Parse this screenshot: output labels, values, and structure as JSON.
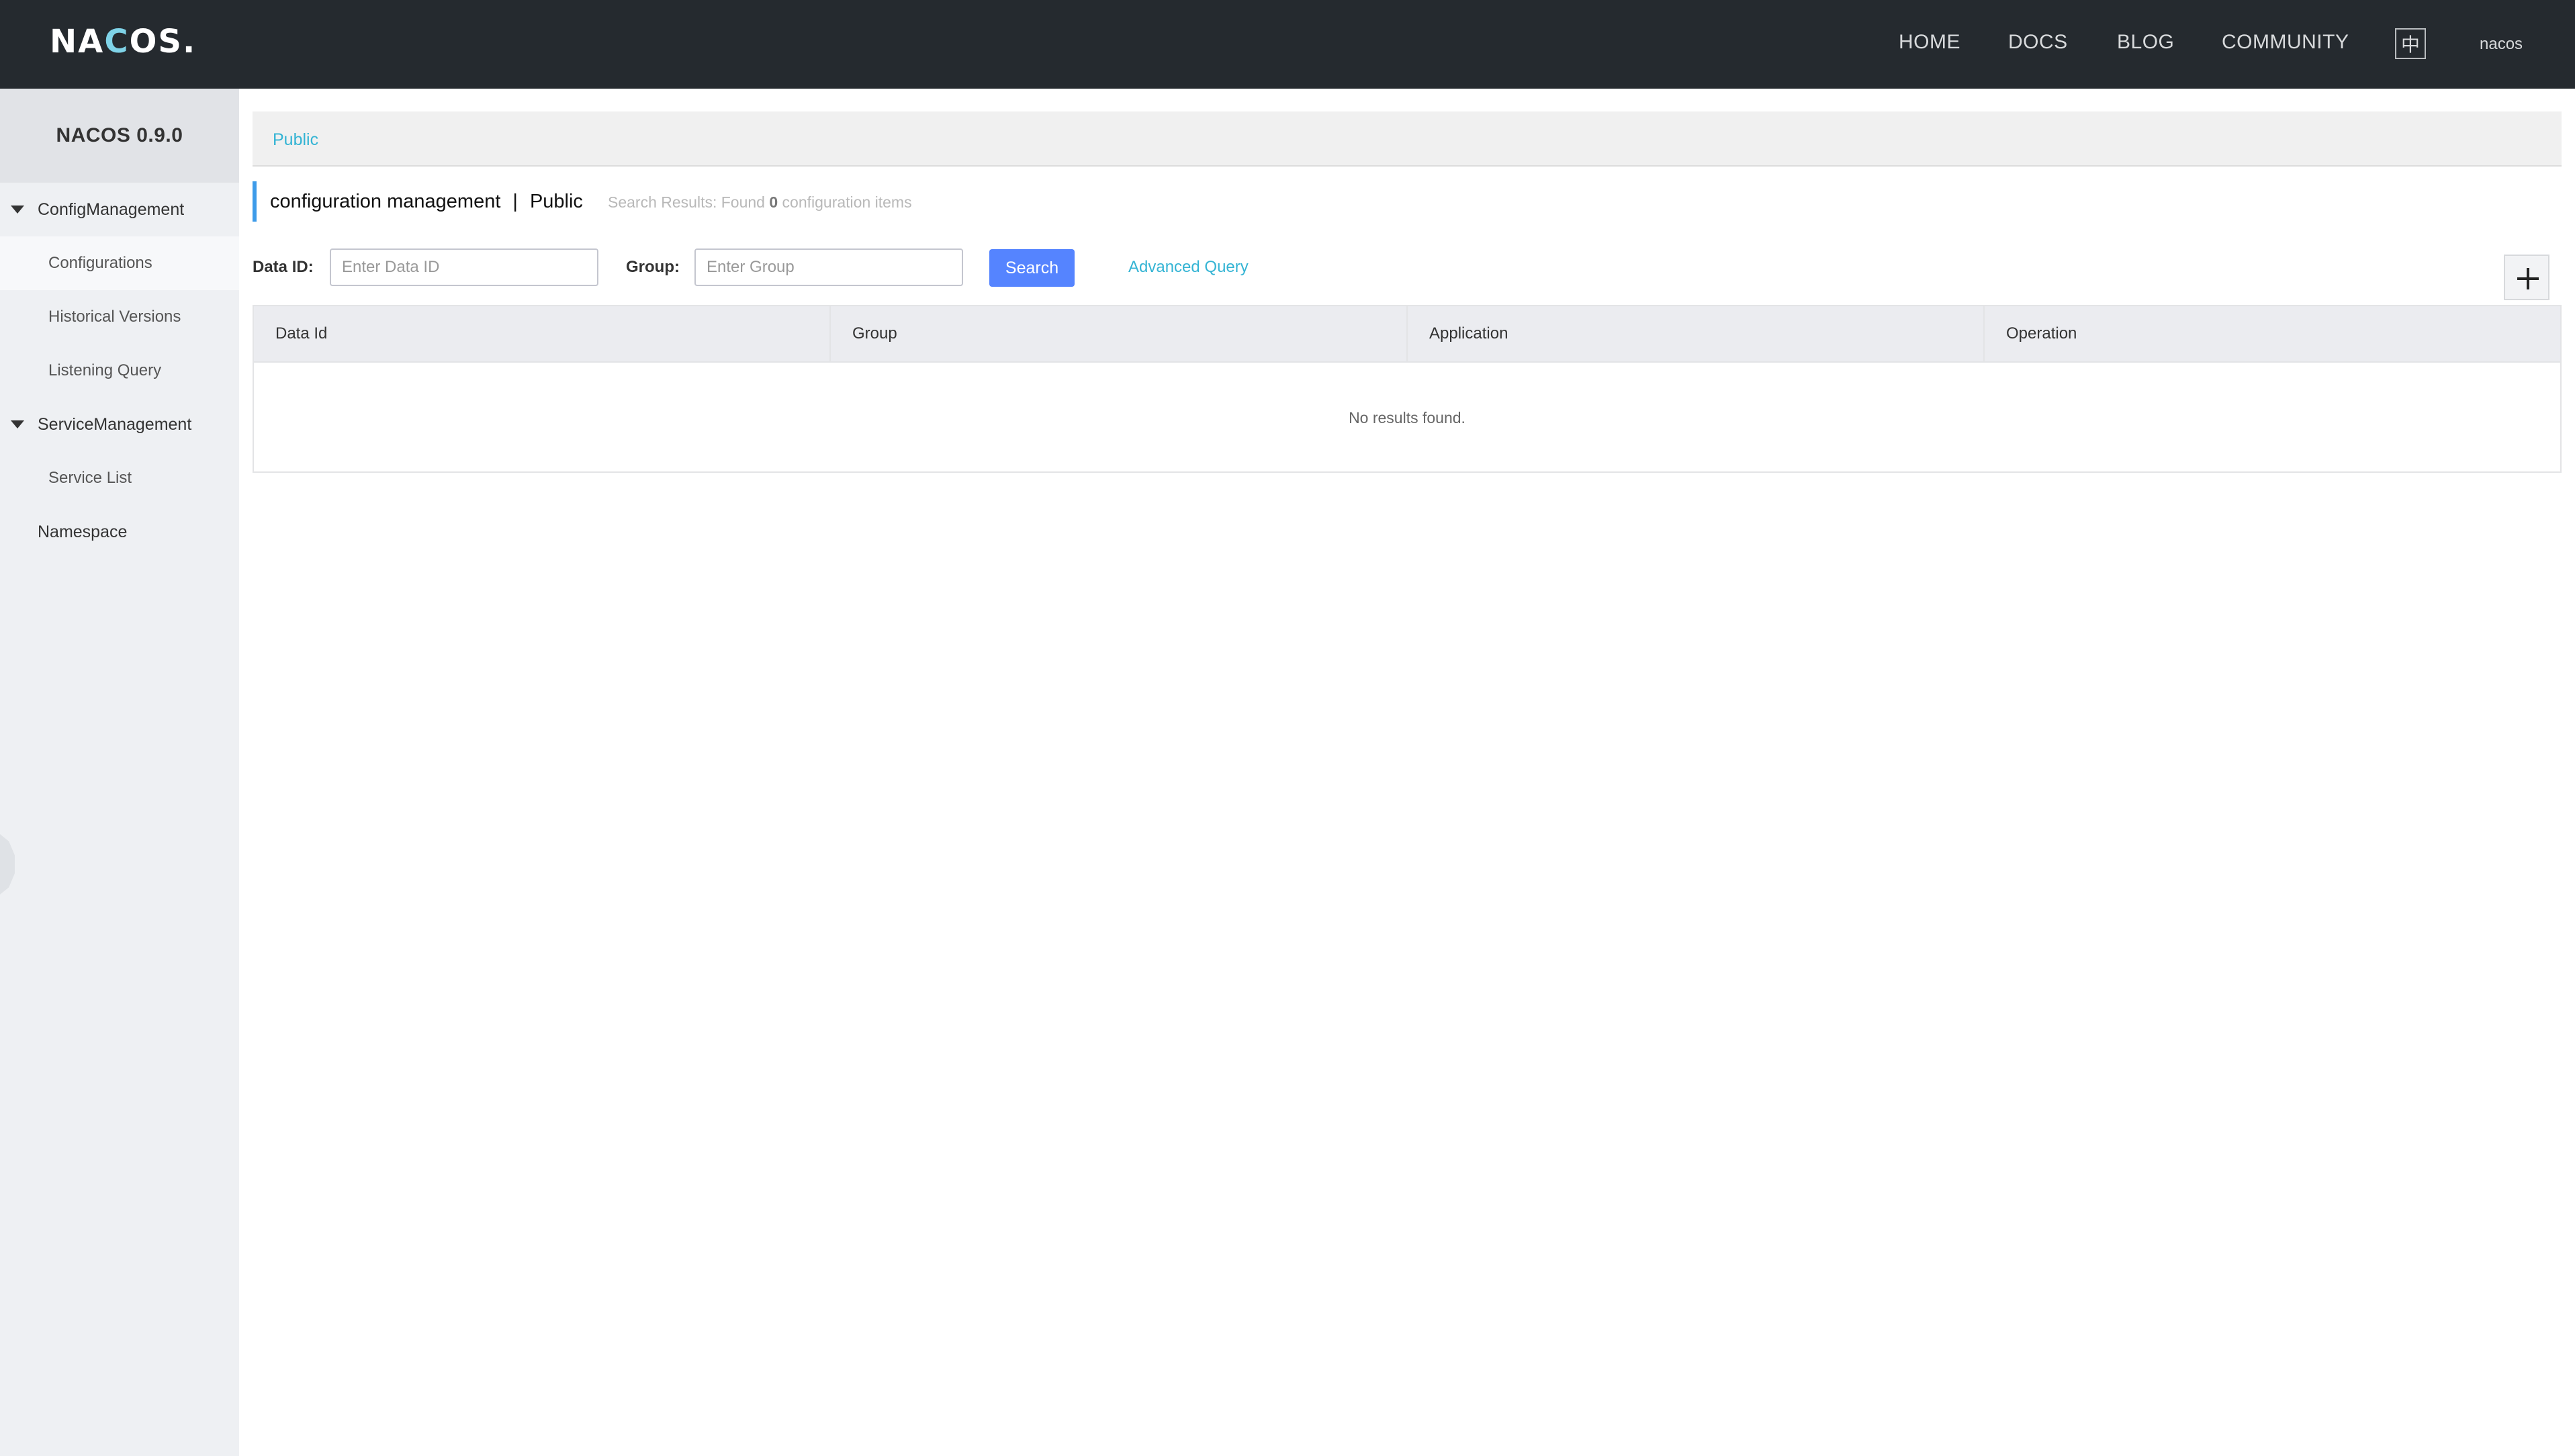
{
  "header": {
    "logo_prefix": "NA",
    "logo_o": "C",
    "logo_suffix": "OS.",
    "nav": [
      "HOME",
      "DOCS",
      "BLOG",
      "COMMUNITY"
    ],
    "lang_button": "中",
    "user": "nacos"
  },
  "sidebar": {
    "title": "NACOS 0.9.0",
    "config_group": "ConfigManagement",
    "config_items": [
      "Configurations",
      "Historical Versions",
      "Listening Query"
    ],
    "service_group": "ServiceManagement",
    "service_items": [
      "Service List"
    ],
    "namespace": "Namespace"
  },
  "breadcrumb": {
    "namespace_link": "Public"
  },
  "heading": {
    "title": "configuration management",
    "separator": "|",
    "namespace": "Public",
    "result_prefix": "Search Results: Found",
    "result_count": "0",
    "result_suffix": "configuration items"
  },
  "filters": {
    "data_id_label": "Data ID:",
    "data_id_placeholder": "Enter Data ID",
    "data_id_value": "",
    "group_label": "Group:",
    "group_placeholder": "Enter Group",
    "group_value": "",
    "search_button": "Search",
    "advanced_query": "Advanced Query"
  },
  "table": {
    "columns": [
      "Data Id",
      "Group",
      "Application",
      "Operation"
    ],
    "empty_text": "No results found."
  },
  "colors": {
    "header_bg": "#252a2f",
    "primary_button": "#5584ff",
    "link": "#34b4d4",
    "heading_accent": "#3d9be9"
  },
  "icons": {
    "add": "plus-icon",
    "expand": "caret-down-icon"
  }
}
